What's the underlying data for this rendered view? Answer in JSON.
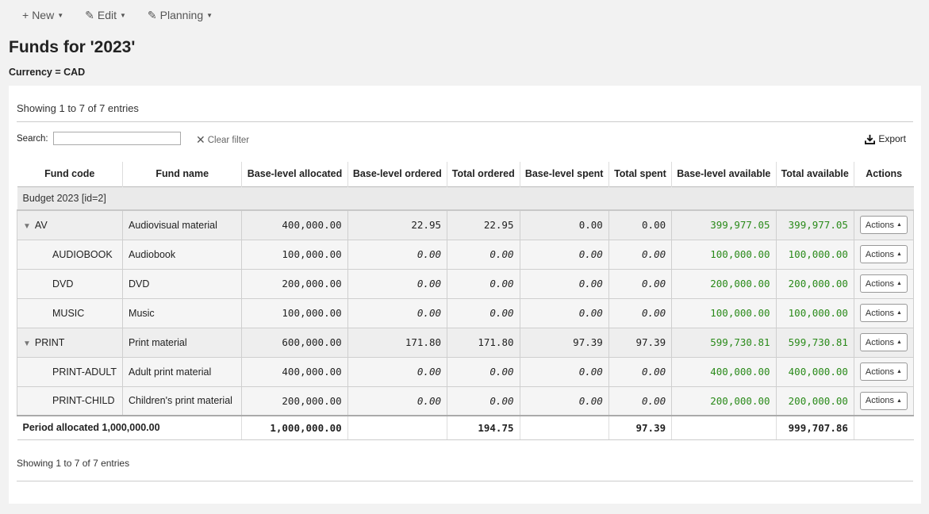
{
  "toolbar": {
    "new_label": "New",
    "edit_label": "Edit",
    "planning_label": "Planning"
  },
  "page": {
    "title": "Funds for '2023'",
    "currency": "Currency = CAD"
  },
  "table_info": {
    "top": "Showing 1 to 7 of 7 entries",
    "bottom": "Showing 1 to 7 of 7 entries"
  },
  "search": {
    "label": "Search:",
    "value": "",
    "clear_label": "Clear filter",
    "export_label": "Export"
  },
  "columns": [
    "Fund code",
    "Fund name",
    "Base-level allocated",
    "Base-level ordered",
    "Total ordered",
    "Base-level spent",
    "Total spent",
    "Base-level available",
    "Total available",
    "Actions"
  ],
  "group_label": "Budget 2023 [id=2]",
  "rows": [
    {
      "code": "AV",
      "name": "Audiovisual material",
      "bl_alloc": "400,000.00",
      "bl_ordered": "22.95",
      "tot_ordered": "22.95",
      "bl_spent": "0.00",
      "tot_spent": "0.00",
      "bl_avail": "399,977.05",
      "tot_avail": "399,977.05",
      "action": "Actions"
    },
    {
      "code": "AUDIOBOOK",
      "name": "Audiobook",
      "bl_alloc": "100,000.00",
      "bl_ordered": "0.00",
      "tot_ordered": "0.00",
      "bl_spent": "0.00",
      "tot_spent": "0.00",
      "bl_avail": "100,000.00",
      "tot_avail": "100,000.00",
      "action": "Actions"
    },
    {
      "code": "DVD",
      "name": "DVD",
      "bl_alloc": "200,000.00",
      "bl_ordered": "0.00",
      "tot_ordered": "0.00",
      "bl_spent": "0.00",
      "tot_spent": "0.00",
      "bl_avail": "200,000.00",
      "tot_avail": "200,000.00",
      "action": "Actions"
    },
    {
      "code": "MUSIC",
      "name": "Music",
      "bl_alloc": "100,000.00",
      "bl_ordered": "0.00",
      "tot_ordered": "0.00",
      "bl_spent": "0.00",
      "tot_spent": "0.00",
      "bl_avail": "100,000.00",
      "tot_avail": "100,000.00",
      "action": "Actions"
    },
    {
      "code": "PRINT",
      "name": "Print material",
      "bl_alloc": "600,000.00",
      "bl_ordered": "171.80",
      "tot_ordered": "171.80",
      "bl_spent": "97.39",
      "tot_spent": "97.39",
      "bl_avail": "599,730.81",
      "tot_avail": "599,730.81",
      "action": "Actions"
    },
    {
      "code": "PRINT-ADULT",
      "name": "Adult print material",
      "bl_alloc": "400,000.00",
      "bl_ordered": "0.00",
      "tot_ordered": "0.00",
      "bl_spent": "0.00",
      "tot_spent": "0.00",
      "bl_avail": "400,000.00",
      "tot_avail": "400,000.00",
      "action": "Actions"
    },
    {
      "code": "PRINT-CHILD",
      "name": "Children's print material",
      "bl_alloc": "200,000.00",
      "bl_ordered": "0.00",
      "tot_ordered": "0.00",
      "bl_spent": "0.00",
      "tot_spent": "0.00",
      "bl_avail": "200,000.00",
      "tot_avail": "200,000.00",
      "action": "Actions"
    }
  ],
  "footer": {
    "label": "Period allocated 1,000,000.00",
    "bl_alloc": "1,000,000.00",
    "tot_ordered": "194.75",
    "tot_spent": "97.39",
    "tot_avail": "999,707.86"
  },
  "colors": {
    "available": "#2a8a1a"
  }
}
